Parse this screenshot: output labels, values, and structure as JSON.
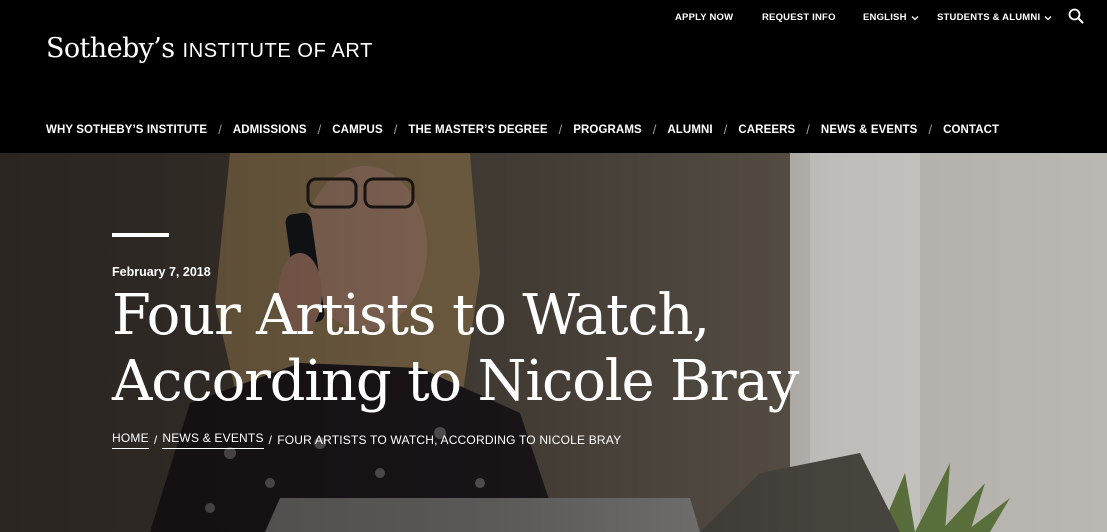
{
  "header": {
    "logo_main": "Sotheby’s",
    "logo_sub": "INSTITUTE OF ART",
    "utility": {
      "apply_now": "APPLY NOW",
      "request_info": "REQUEST INFO",
      "language": "ENGLISH",
      "students_alumni": "STUDENTS & ALUMNI",
      "search_icon": "search-icon"
    },
    "nav": [
      "WHY SOTHEBY’S INSTITUTE",
      "ADMISSIONS",
      "CAMPUS",
      "THE MASTER’S DEGREE",
      "PROGRAMS",
      "ALUMNI",
      "CAREERS",
      "NEWS & EVENTS",
      "CONTACT"
    ],
    "nav_separator": "/"
  },
  "hero": {
    "date": "February 7, 2018",
    "title_line1": "Four Artists to Watch,",
    "title_line2": "According to Nicole Bray",
    "breadcrumb": {
      "home": "HOME",
      "section": "NEWS & EVENTS",
      "current": "FOUR ARTISTS TO WATCH, ACCORDING TO NICOLE BRAY",
      "separator": "/"
    }
  }
}
